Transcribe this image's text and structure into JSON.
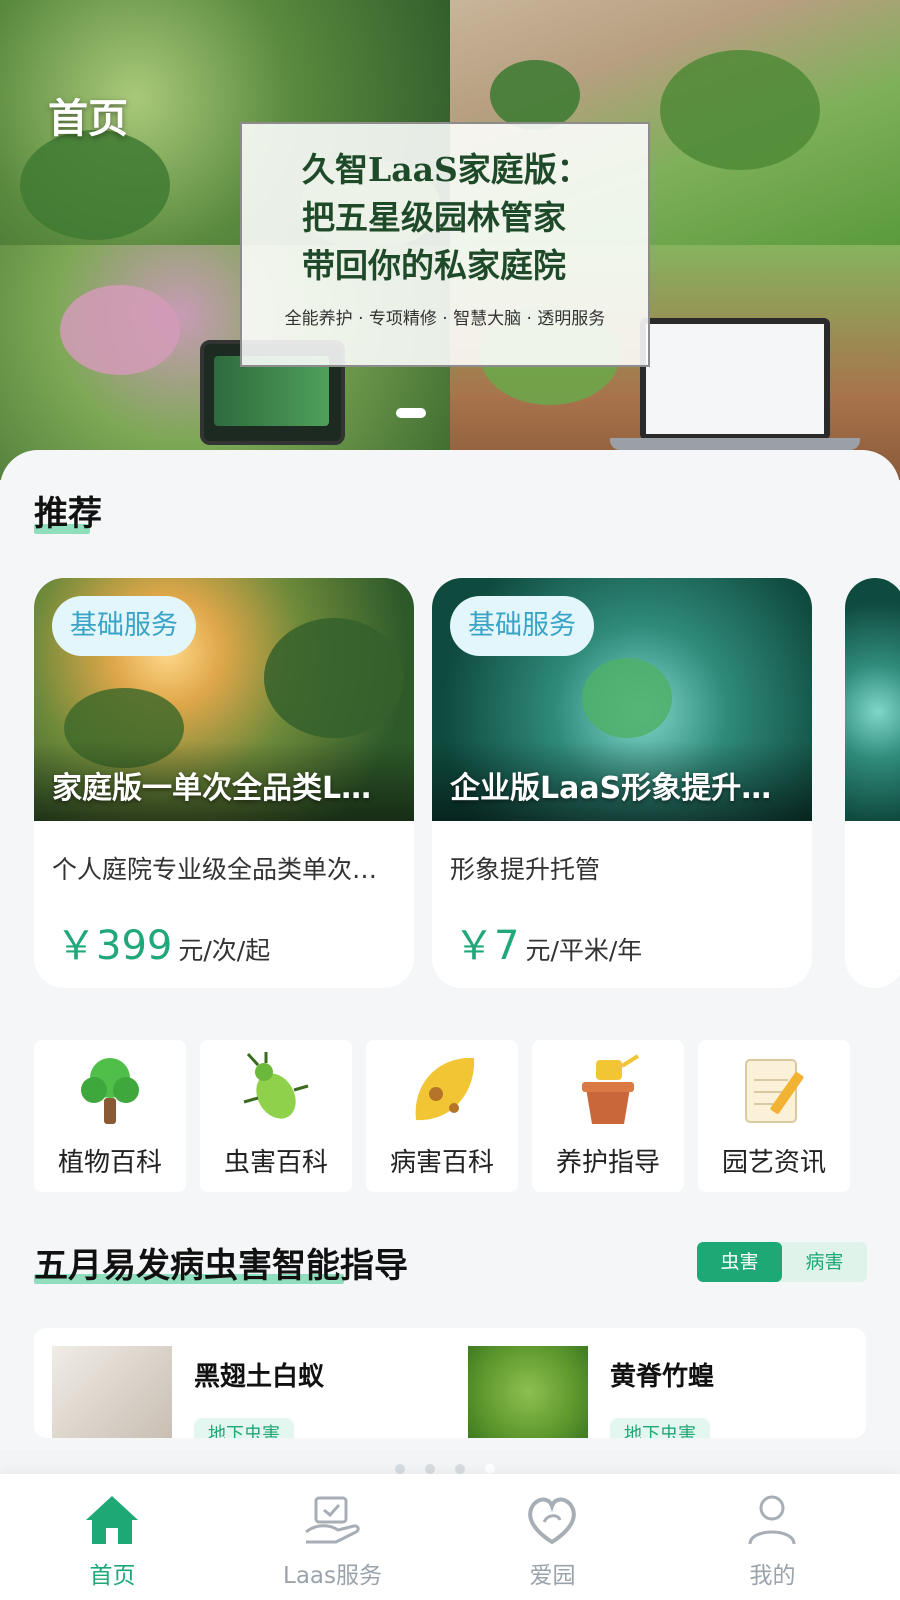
{
  "header": {
    "page_title": "首页"
  },
  "banner": {
    "headline_line1": "久智LaaS家庭版：",
    "headline_line2": "把五星级园林管家",
    "headline_line3": "带回你的私家庭院",
    "subline": "全能养护 · 专项精修 · 智慧大脑 · 透明服务"
  },
  "recommend": {
    "title": "推荐",
    "cards": [
      {
        "tag": "基础服务",
        "name": "家庭版一单次全品类L…",
        "desc": "个人庭院专业级全品类单次…",
        "price": "￥399",
        "unit": "元/次/起"
      },
      {
        "tag": "基础服务",
        "name": "企业版LaaS形象提升…",
        "desc": "形象提升托管",
        "price": "￥7",
        "unit": "元/平米/年"
      }
    ]
  },
  "categories": [
    {
      "label": "植物百科",
      "icon": "tree-icon"
    },
    {
      "label": "虫害百科",
      "icon": "bug-icon"
    },
    {
      "label": "病害百科",
      "icon": "leaf-disease-icon"
    },
    {
      "label": "养护指导",
      "icon": "watering-pot-icon"
    },
    {
      "label": "园艺资讯",
      "icon": "notepad-icon"
    }
  ],
  "guide": {
    "title": "五月易发病虫害智能指导",
    "toggle_active": "虫害",
    "toggle_inactive": "病害",
    "items": [
      {
        "name": "黑翅土白蚁",
        "tag": "地下虫害"
      },
      {
        "name": "黄脊竹蝗",
        "tag": "地下虫害"
      }
    ]
  },
  "bottom_nav": [
    {
      "label": "首页",
      "active": true
    },
    {
      "label": "Laas服务",
      "active": false
    },
    {
      "label": "爱园",
      "active": false
    },
    {
      "label": "我的",
      "active": false
    }
  ],
  "colors": {
    "accent": "#1ea876",
    "tag_bg": "#e3f6fb",
    "tag_text": "#3aa3c6"
  }
}
